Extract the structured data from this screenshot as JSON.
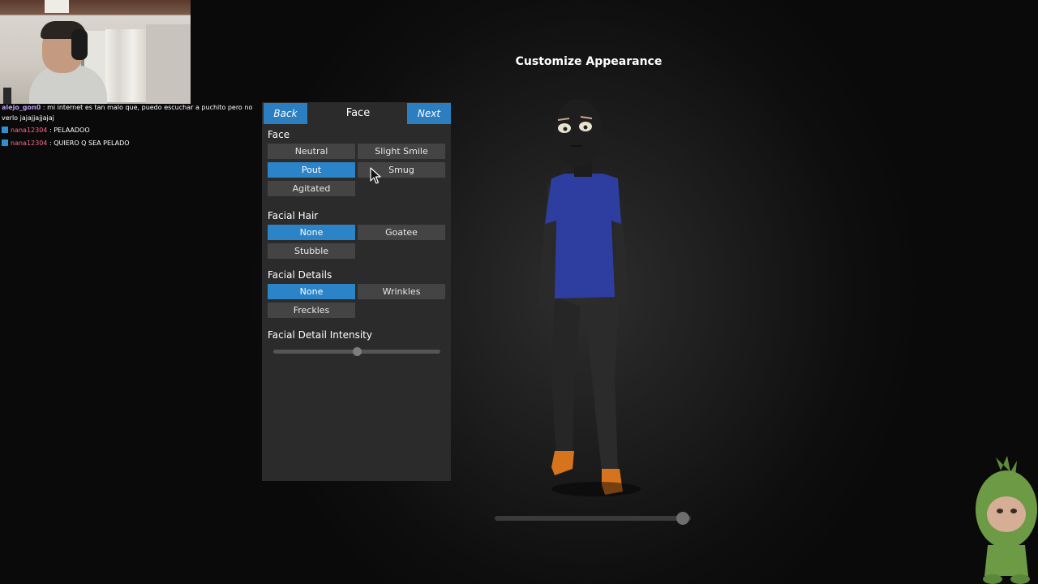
{
  "scene": {
    "title": "Customize Appearance"
  },
  "chat": {
    "messages": [
      {
        "user": "alejo_gon0",
        "text": ": mi internet es tan malo que, puedo escuchar a puchito pero no verlo jajajjajjajaj"
      },
      {
        "user": "nana12304",
        "text": ": PELAADOO"
      },
      {
        "user": "nana12304",
        "text": ": QUIERO Q SEA PELADO"
      }
    ]
  },
  "panel": {
    "back_label": "Back",
    "title": "Face",
    "next_label": "Next",
    "sections": {
      "face": {
        "label": "Face",
        "options": [
          "Neutral",
          "Slight Smile",
          "Pout",
          "Smug",
          "Agitated"
        ],
        "selected": "Pout"
      },
      "facial_hair": {
        "label": "Facial Hair",
        "options": [
          "None",
          "Goatee",
          "Stubble"
        ],
        "selected": "None"
      },
      "facial_details": {
        "label": "Facial Details",
        "options": [
          "None",
          "Wrinkles",
          "Freckles"
        ],
        "selected": "None"
      },
      "intensity": {
        "label": "Facial Detail Intensity",
        "value": 0.5
      }
    }
  },
  "rotation": {
    "value": 0.96
  },
  "colors": {
    "accent": "#2b83c8",
    "panel_bg": "#2b2b2b",
    "button_bg": "#444444",
    "shirt": "#2e3ea0",
    "shoes": "#d6741e"
  }
}
